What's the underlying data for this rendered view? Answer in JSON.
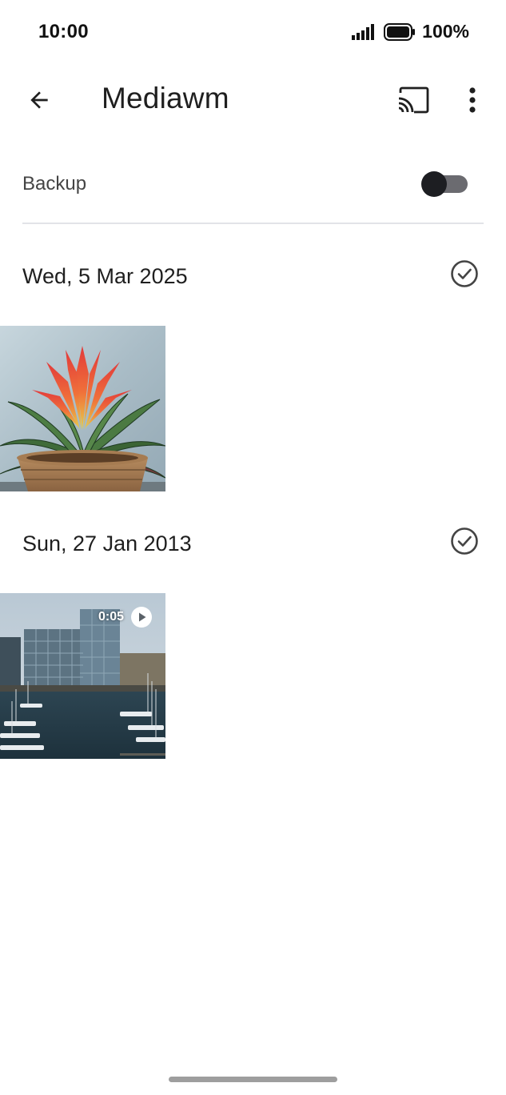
{
  "status_bar": {
    "time": "10:00",
    "battery_text": "100%",
    "signal_icon": "signal-bars-icon",
    "battery_icon": "battery-full-icon"
  },
  "app_bar": {
    "back_icon": "arrow-back-icon",
    "title": "Mediawm",
    "cast_icon": "cast-icon",
    "more_icon": "more-vert-icon"
  },
  "backup": {
    "label": "Backup",
    "enabled": false
  },
  "sections": [
    {
      "date": "Wed, 5 Mar 2025",
      "select_icon": "check-circle-icon",
      "items": [
        {
          "type": "photo",
          "subject": "potted bromeliad plant"
        }
      ]
    },
    {
      "date": "Sun, 27 Jan 2013",
      "select_icon": "check-circle-icon",
      "items": [
        {
          "type": "video",
          "duration": "0:05",
          "play_icon": "play-circle-icon",
          "subject": "harbor with glass office buildings and boats"
        }
      ]
    }
  ],
  "colors": {
    "toggle_thumb": "#1d1e22",
    "toggle_track": "#6b6b70",
    "divider": "#e2e3e8"
  }
}
